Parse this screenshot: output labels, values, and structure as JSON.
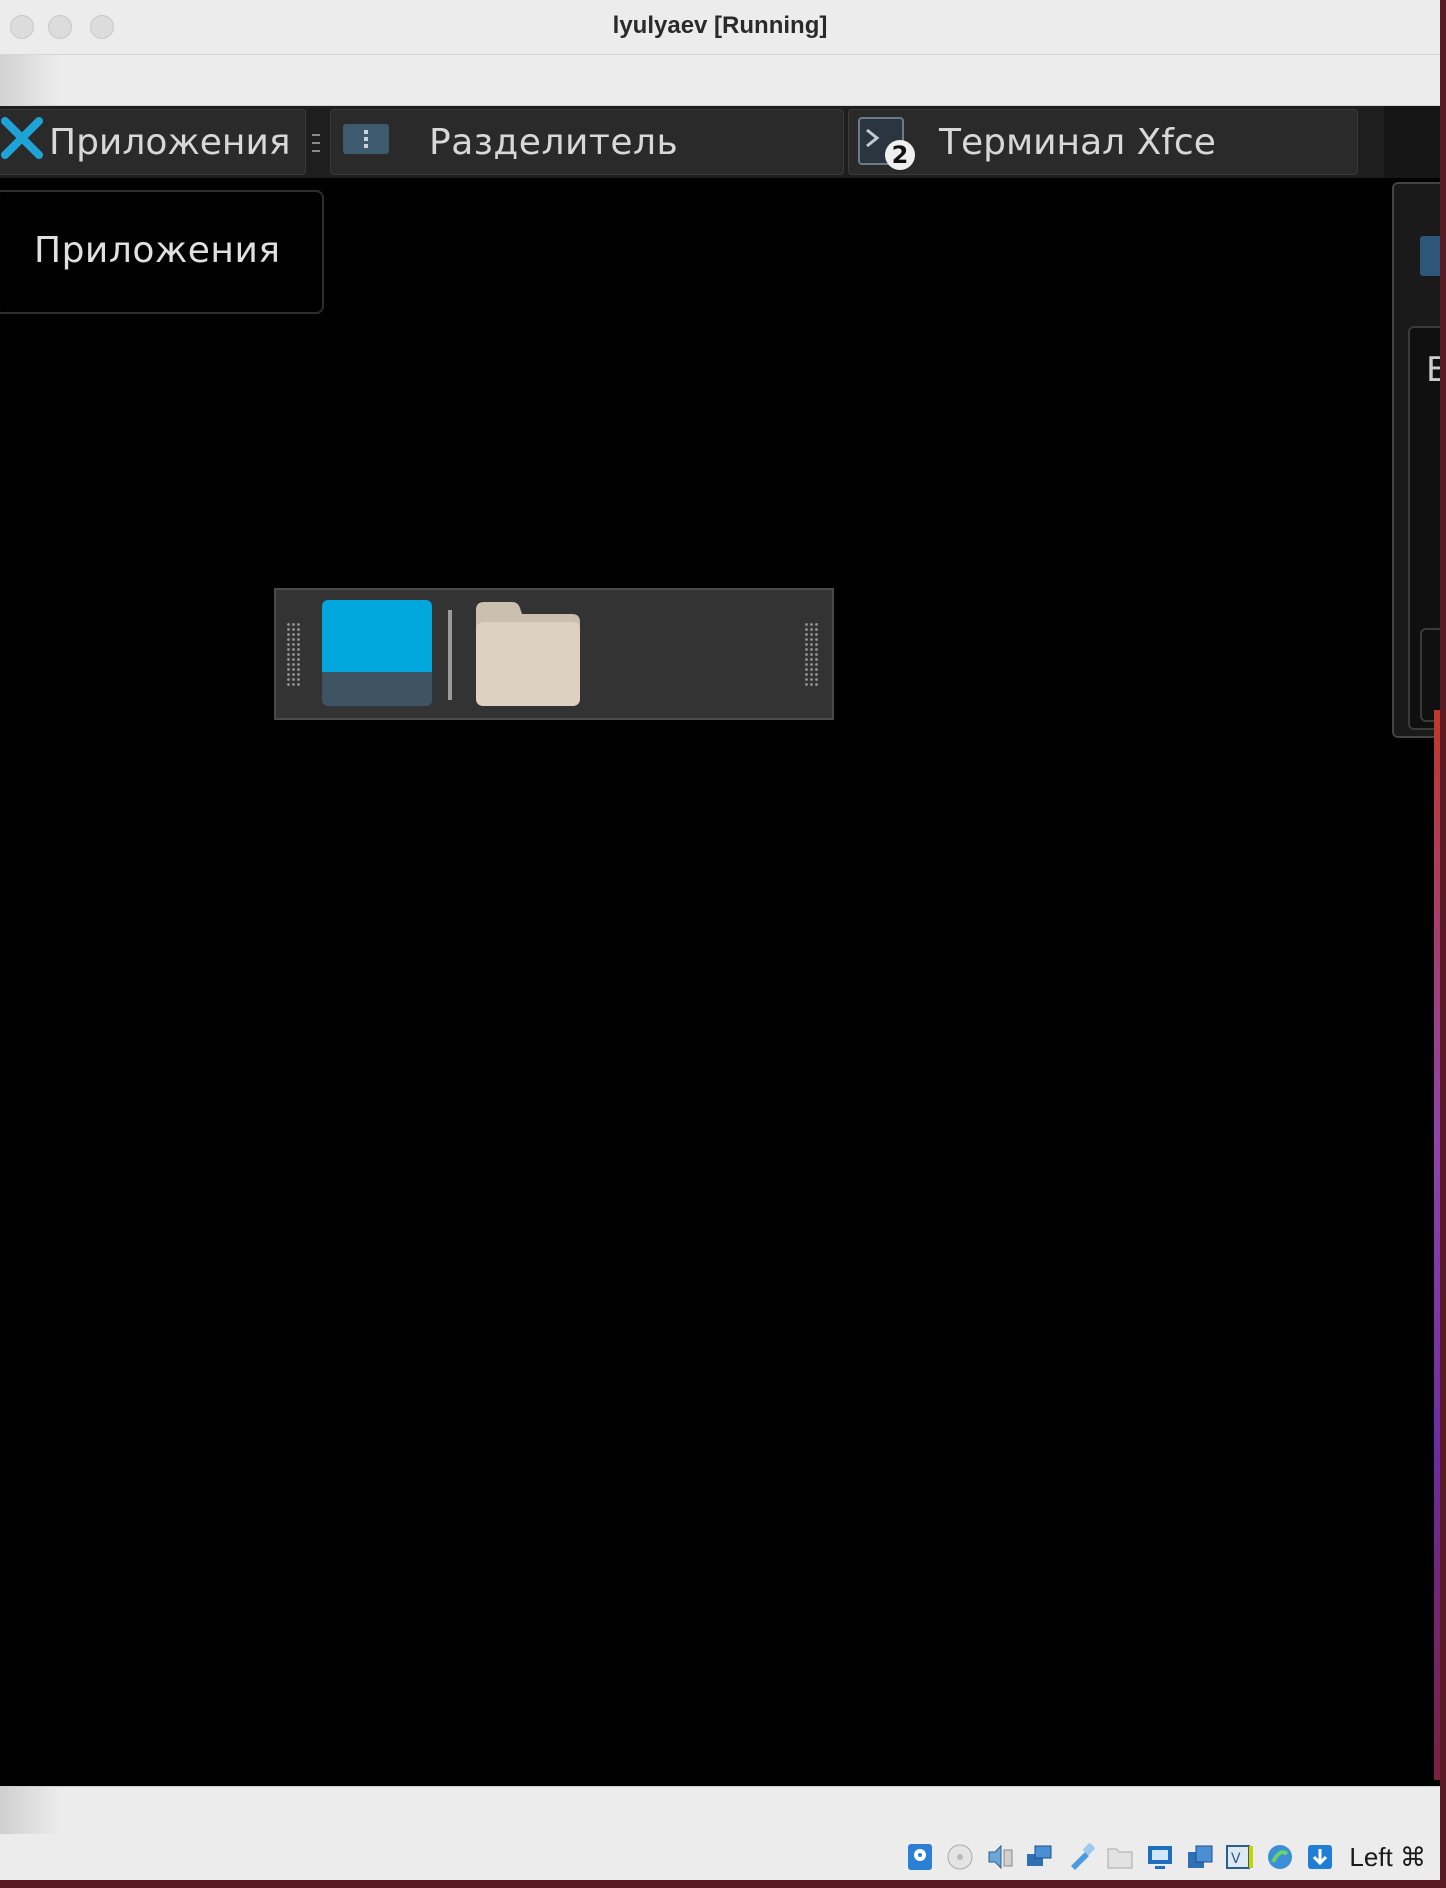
{
  "window": {
    "title": "lyulyaev [Running]"
  },
  "panel": {
    "apps_label": "Приложения",
    "separator_label": "Разделитель",
    "terminal_label": "Терминал Xfce",
    "terminal_badge": "2"
  },
  "apps_menu": {
    "item_label": "Приложения"
  },
  "side_window": {
    "partial_letter": "E"
  },
  "statusbar": {
    "host_key": "Left ⌘",
    "icons": [
      "hard-disk-icon",
      "optical-drive-icon",
      "audio-icon",
      "network-icon",
      "usb-icon",
      "shared-folders-icon",
      "display-icon",
      "video-capture-icon",
      "vrde-icon",
      "recording-icon",
      "mouse-integration-icon"
    ]
  },
  "colors": {
    "accent_blue": "#00a6dc",
    "folder_beige": "#ddd1c3",
    "panel_bg": "#1e1e1e"
  }
}
